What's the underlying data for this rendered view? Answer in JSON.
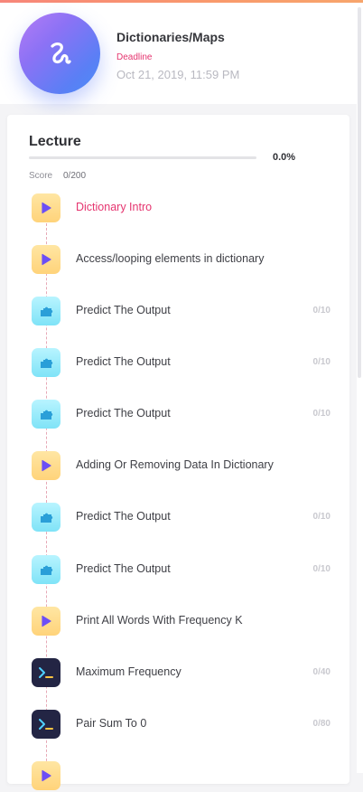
{
  "header": {
    "title": "Dictionaries/Maps",
    "deadline_label": "Deadline",
    "deadline_date": "Oct 21, 2019, 11:59 PM"
  },
  "lecture": {
    "title": "Lecture",
    "progress_text": "0.0%",
    "progress_value": 0.0,
    "score_label": "Score",
    "score_value": "0/200"
  },
  "items": [
    {
      "type": "video",
      "icon": "play-icon",
      "label": "Dictionary Intro",
      "score": "",
      "active": true
    },
    {
      "type": "video",
      "icon": "play-icon",
      "label": "Access/looping elements in dictionary",
      "score": "",
      "active": false
    },
    {
      "type": "quiz",
      "icon": "puzzle-icon",
      "label": "Predict The Output",
      "score": "0/10",
      "active": false
    },
    {
      "type": "quiz",
      "icon": "puzzle-icon",
      "label": "Predict The Output",
      "score": "0/10",
      "active": false
    },
    {
      "type": "quiz",
      "icon": "puzzle-icon",
      "label": "Predict The Output",
      "score": "0/10",
      "active": false
    },
    {
      "type": "video",
      "icon": "play-icon",
      "label": "Adding Or Removing Data In Dictionary",
      "score": "",
      "active": false
    },
    {
      "type": "quiz",
      "icon": "puzzle-icon",
      "label": "Predict The Output",
      "score": "0/10",
      "active": false
    },
    {
      "type": "quiz",
      "icon": "puzzle-icon",
      "label": "Predict The Output",
      "score": "0/10",
      "active": false
    },
    {
      "type": "video",
      "icon": "play-icon",
      "label": "Print All Words With Frequency K",
      "score": "",
      "active": false
    },
    {
      "type": "code",
      "icon": "terminal-icon",
      "label": "Maximum Frequency",
      "score": "0/40",
      "active": false
    },
    {
      "type": "code",
      "icon": "terminal-icon",
      "label": "Pair Sum To 0",
      "score": "0/80",
      "active": false
    },
    {
      "type": "video",
      "icon": "play-icon",
      "label": "",
      "score": "",
      "active": false
    }
  ],
  "colors": {
    "accent_pink": "#e5346f",
    "play_purple": "#6c4ef5",
    "quiz_blue": "#2a9fd8",
    "code_bg": "#232544"
  }
}
